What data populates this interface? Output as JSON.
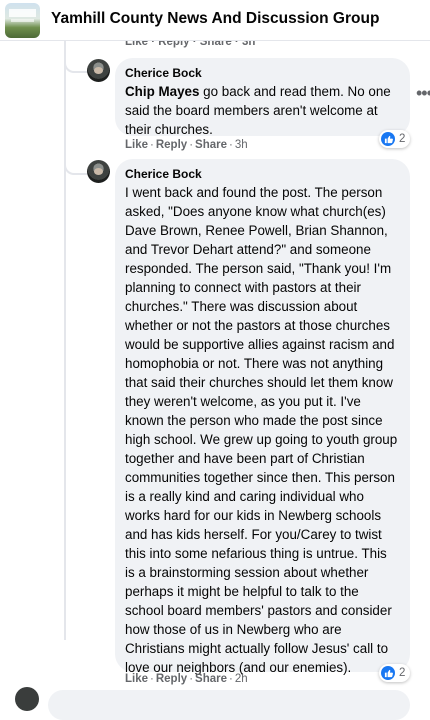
{
  "header": {
    "group_title": "Yamhill County News And Discussion Group"
  },
  "prior_comment": {
    "actions": "Like · Reply · Share · 3h"
  },
  "comments": [
    {
      "author": "Cherice Bock",
      "mention": "Chip Mayes",
      "text": " go back and read them. No one said the board members aren't welcome at their churches.",
      "reaction_count": "2",
      "actions": {
        "like": "Like",
        "reply": "Reply",
        "share": "Share",
        "time": "3h"
      }
    },
    {
      "author": "Cherice Bock",
      "text": "I went back and found the post. The person asked, \"Does anyone know what church(es) Dave Brown, Renee Powell, Brian Shannon, and Trevor Dehart attend?\" and someone responded. The person said, \"Thank you! I'm planning to connect with pastors at their churches.\" There was discussion about whether or not the pastors at those churches would be supportive allies against racism and homophobia or not. There was not anything that said their churches should let them know they weren't welcome, as you put it. I've known the person who made the post since high school. We grew up going to youth group together and have been part of Christian communities together since then. This person is a really kind and caring individual who works hard for our kids in Newberg schools and has kids herself. For you/Carey to twist this into some nefarious thing is untrue. This is a brainstorming session about whether perhaps it might be helpful to talk to the school board members' pastors and consider how those of us in Newberg who are Christians might actually follow Jesus' call to love our neighbors (and our enemies).",
      "reaction_count": "2",
      "actions": {
        "like": "Like",
        "reply": "Reply",
        "share": "Share",
        "time": "2h"
      }
    }
  ],
  "icons": {
    "group_avatar": "group-cover-photo",
    "like_reaction": "thumbs-up-icon",
    "more": "more-options-icon"
  },
  "colors": {
    "like_blue": "#1877f2",
    "bubble": "#f0f2f5",
    "meta_gray": "#65676b"
  }
}
